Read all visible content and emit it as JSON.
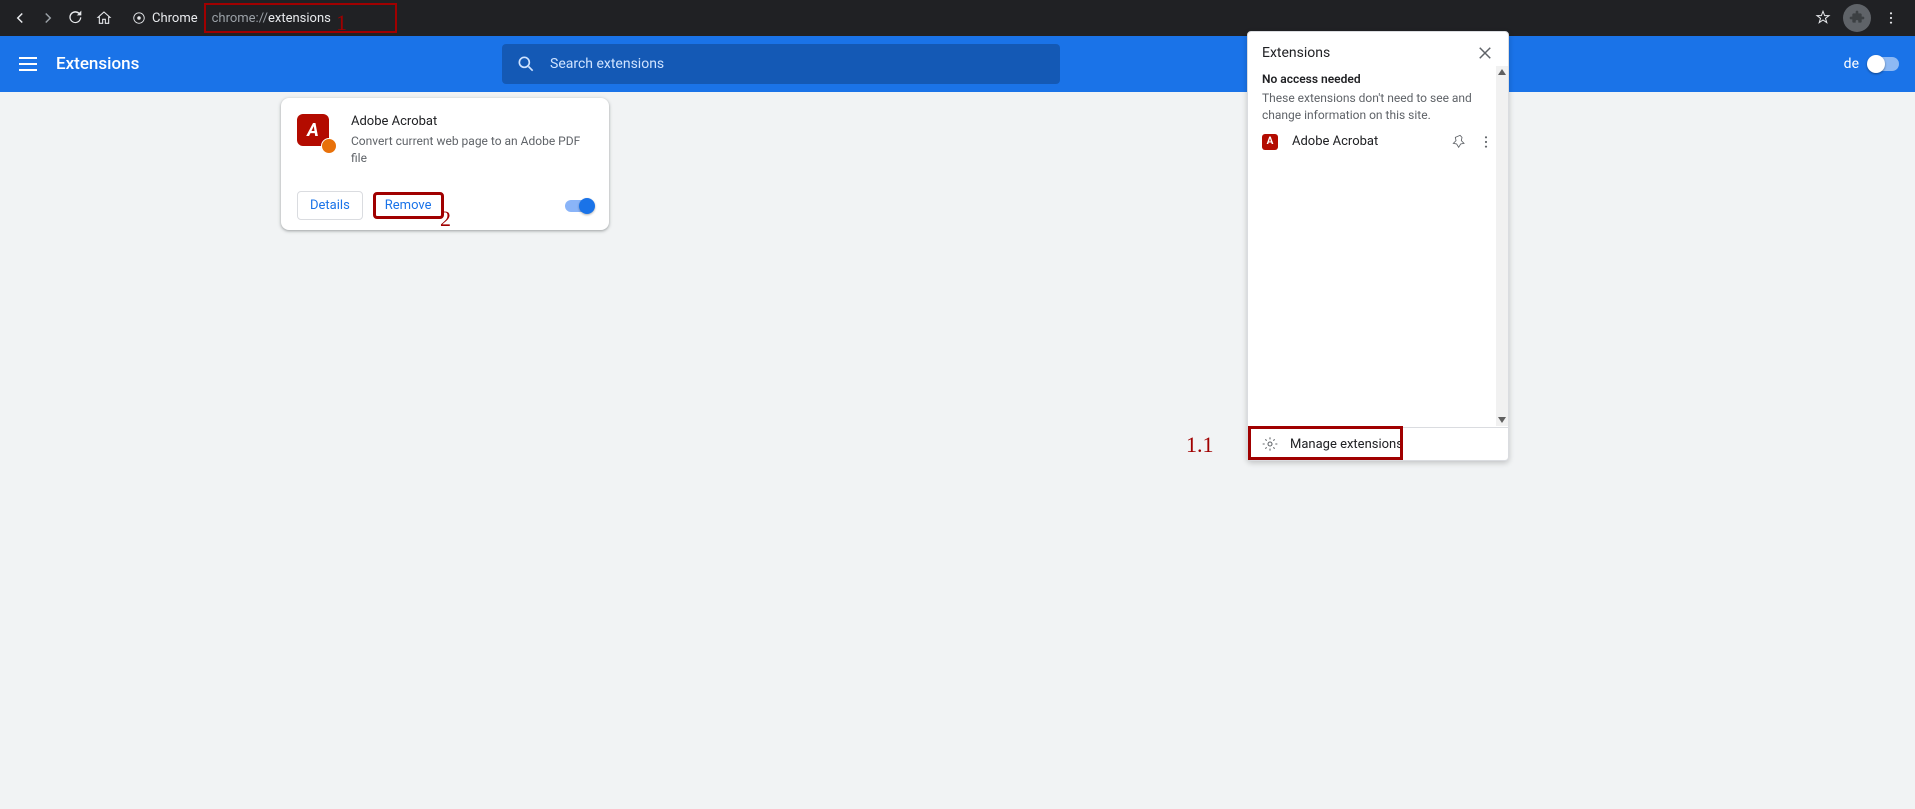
{
  "browser": {
    "label": "Chrome",
    "url_dim": "chrome://",
    "url_bright": "extensions"
  },
  "header": {
    "title": "Extensions",
    "search_placeholder": "Search extensions",
    "dev_mode_label": "de"
  },
  "card": {
    "name": "Adobe Acrobat",
    "desc": "Convert current web page to an Adobe PDF file",
    "details": "Details",
    "remove": "Remove"
  },
  "popup": {
    "title": "Extensions",
    "no_access": "No access needed",
    "access_text": "These extensions don't need to see and change information on this site.",
    "item_name": "Adobe Acrobat",
    "manage": "Manage extensions"
  },
  "annotations": {
    "a1": "1",
    "a2": "2",
    "a11": "1.1"
  }
}
